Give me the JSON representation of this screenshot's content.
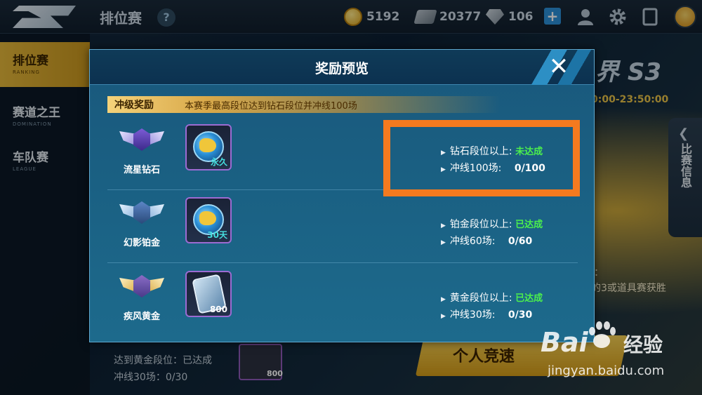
{
  "topbar": {
    "title": "排位赛",
    "help": "?",
    "coins": "5192",
    "gems": "20377",
    "diamonds": "106",
    "plus": "+"
  },
  "sidebar": {
    "items": [
      {
        "label": "排位赛",
        "sub": "RANKING"
      },
      {
        "label": "赛道之王",
        "sub": "DOMINATION"
      },
      {
        "label": "车队赛",
        "sub": "LEAGUE"
      }
    ]
  },
  "background": {
    "season_logo": "界 S3",
    "season_time": "0:00-23:50:00",
    "match_info": "比赛信息",
    "match_info_arrow": "❮",
    "right_text1": "：",
    "right_text2": "的3或道具赛获胜",
    "personal_race": "个人竞速",
    "bottom_line1": "达到黄金段位：已达成",
    "bottom_line2": "冲线30场：0/30",
    "bottom_card_num": "800"
  },
  "modal": {
    "title": "奖励预览",
    "close": "✕",
    "promo_label": "冲级奖励",
    "promo_desc": "本赛季最高段位达到钻石段位并冲线100场",
    "rows": [
      {
        "rank_name": "流星钻石",
        "reward_tag": "永久",
        "req1_label": "钻石段位以上:",
        "req1_status": "未达成",
        "req2_label": "冲线100场:",
        "req2_progress": "0/100"
      },
      {
        "rank_name": "幻影铂金",
        "reward_tag": "30天",
        "req1_label": "铂金段位以上:",
        "req1_status": "已达成",
        "req2_label": "冲线60场:",
        "req2_progress": "0/60"
      },
      {
        "rank_name": "疾风黄金",
        "reward_tag": "800",
        "req1_label": "黄金段位以上:",
        "req1_status": "已达成",
        "req2_label": "冲线30场:",
        "req2_progress": "0/30"
      }
    ]
  },
  "watermark": {
    "brand": "Bai",
    "brand2": "经验",
    "url": "jingyan.baidu.com"
  },
  "colors": {
    "accent_gold": "#e3b63a",
    "status_green": "#4cf04c",
    "highlight_orange": "#f47a1f",
    "modal_blue": "#1a5f82"
  }
}
